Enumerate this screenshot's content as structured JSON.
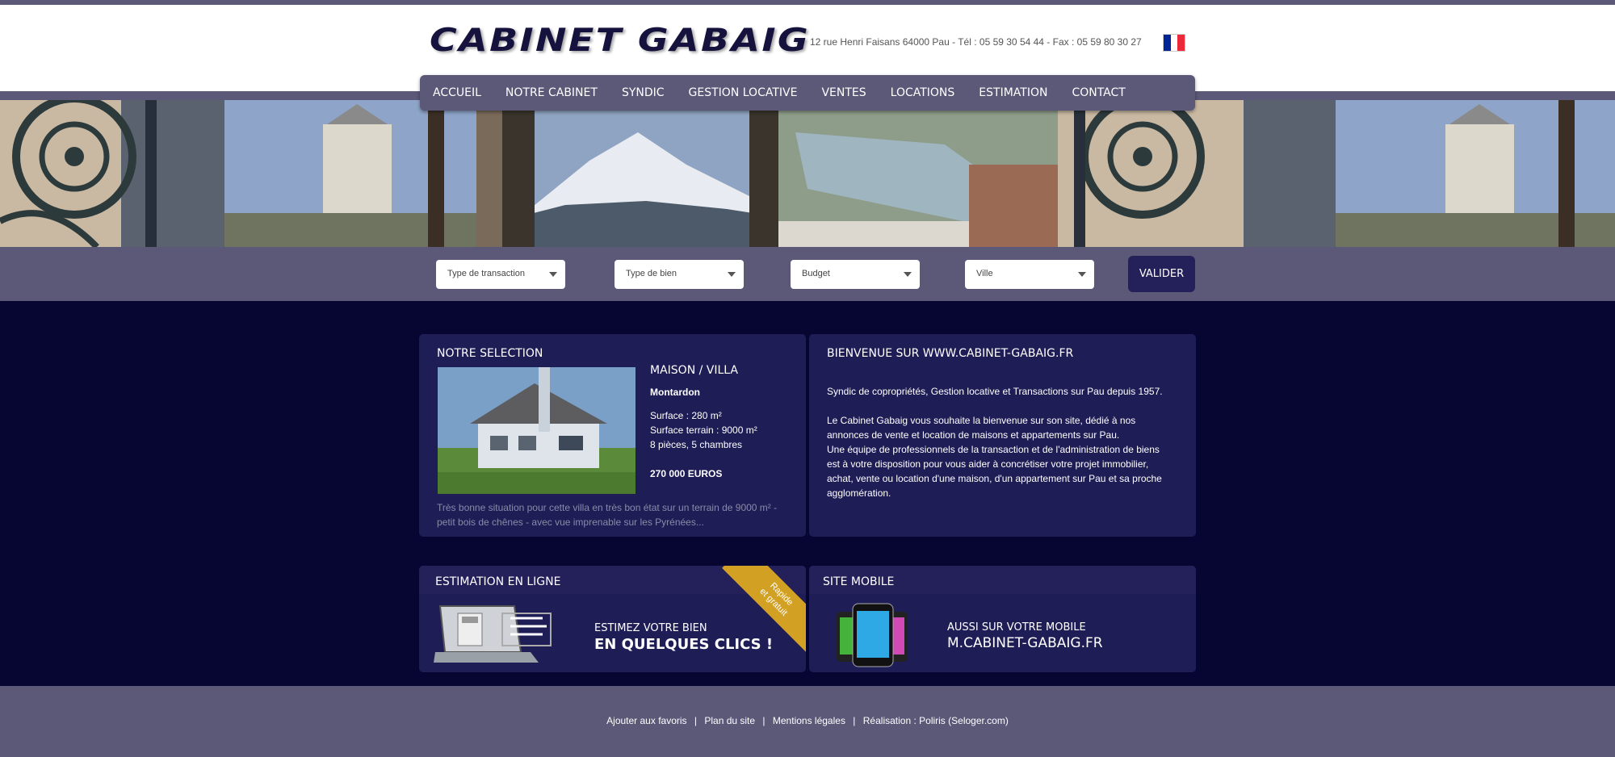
{
  "header": {
    "logo": "CABINET GABAIG",
    "contact": "12 rue Henri Faisans 64000 Pau - Tél : 05 59 30 54 44 - Fax : 05 59 80 30 27",
    "flag_colors": [
      "#002395",
      "#ffffff",
      "#ed2939"
    ]
  },
  "nav": {
    "items": [
      {
        "label": "ACCUEIL"
      },
      {
        "label": "NOTRE CABINET"
      },
      {
        "label": "SYNDIC"
      },
      {
        "label": "GESTION LOCATIVE"
      },
      {
        "label": "VENTES"
      },
      {
        "label": "LOCATIONS"
      },
      {
        "label": "ESTIMATION"
      },
      {
        "label": "CONTACT"
      }
    ]
  },
  "search": {
    "transaction": "Type de transaction",
    "bien": "Type de bien",
    "budget": "Budget",
    "ville": "Ville",
    "submit": "VALIDER"
  },
  "selection": {
    "title": "NOTRE SELECTION",
    "type": "MAISON / VILLA",
    "city": "Montardon",
    "surface": "Surface : 280 m²",
    "terrain": "Surface terrain : 9000 m²",
    "rooms": "8 pièces, 5 chambres",
    "price": "270 000 EUROS",
    "description": "Très bonne situation pour cette villa en très bon état sur un terrain de 9000 m² - petit bois de chênes - avec vue imprenable sur les Pyrénées..."
  },
  "welcome": {
    "title": "BIENVENUE SUR WWW.CABINET-GABAIG.FR",
    "p1": "Syndic de copropriétés, Gestion locative et Transactions sur Pau depuis 1957.",
    "p2": "Le Cabinet Gabaig vous souhaite la bienvenue sur son site, dédié à nos annonces de vente et location de maisons et appartements sur Pau.",
    "p3": "Une équipe de professionnels de la transaction et de l'administration de biens est à votre disposition pour vous aider à concrétiser votre projet immobilier, achat, vente ou location d'une maison, d'un appartement sur Pau et sa proche agglomération."
  },
  "estimation": {
    "title": "ESTIMATION EN LIGNE",
    "ribbon1": "Rapide",
    "ribbon2": "et gratuit",
    "line1": "ESTIMEZ VOTRE BIEN",
    "line2": "EN QUELQUES CLICS !"
  },
  "mobile": {
    "title": "SITE MOBILE",
    "line1": "AUSSI SUR VOTRE MOBILE",
    "line2": "M.CABINET-GABAIG.FR"
  },
  "footer": {
    "fav": "Ajouter aux favoris",
    "plan": "Plan du site",
    "legal": "Mentions légales",
    "credit": "Réalisation : Poliris (Seloger.com)",
    "sep": "|"
  }
}
